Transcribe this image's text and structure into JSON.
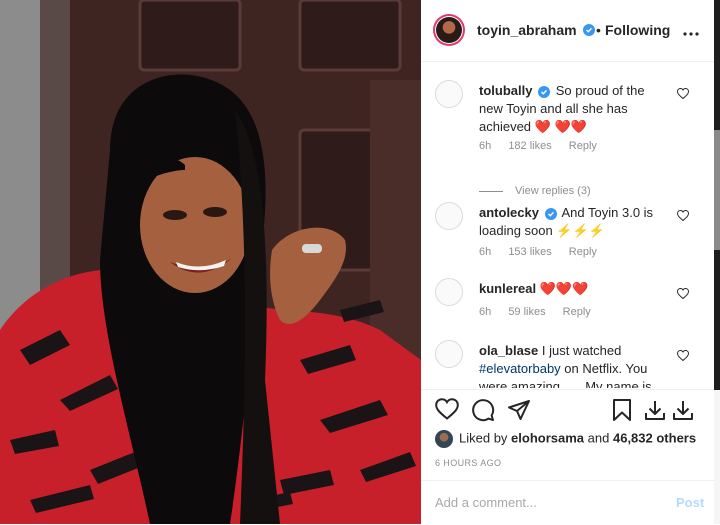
{
  "header": {
    "username": "toyin_abraham",
    "separator": "•",
    "following_label": "Following",
    "more_icon": "more-horizontal-icon"
  },
  "comments": [
    {
      "username": "tolubally",
      "verified": true,
      "text": "So proud of the new Toyin and all she has achieved",
      "emoji": "❤️",
      "emoji2": "❤️❤️",
      "time": "6h",
      "likes": "182 likes",
      "reply": "Reply",
      "view_replies": "View replies (3)"
    },
    {
      "username": "antolecky",
      "verified": true,
      "text": "And Toyin 3.0 is loading soon",
      "emoji": "⚡⚡⚡",
      "time": "6h",
      "likes": "153 likes",
      "reply": "Reply"
    },
    {
      "username": "kunlereal",
      "verified": false,
      "text": "",
      "emoji": "❤️❤️❤️",
      "time": "6h",
      "likes": "59 likes",
      "reply": "Reply"
    },
    {
      "username": "ola_blase",
      "verified": false,
      "text_pre": "I just watched",
      "hashtag": "#elevatorbaby",
      "text_post": "on Netflix. You were amazing...... My name is"
    }
  ],
  "actions": {
    "icons": [
      "heart-icon",
      "comment-icon",
      "share-icon",
      "save-icon",
      "download-icon",
      "download-icon"
    ]
  },
  "likes": {
    "prefix": "Liked by",
    "user": "elohorsama",
    "and": "and",
    "count": "46,832 others"
  },
  "timestamp": "6 HOURS AGO",
  "add_comment": {
    "placeholder": "Add a comment...",
    "post_label": "Post"
  },
  "colors": {
    "verified": "#3897f0",
    "link": "#00376b",
    "post_disabled": "#b3dbff",
    "heart": "#ed4956"
  }
}
